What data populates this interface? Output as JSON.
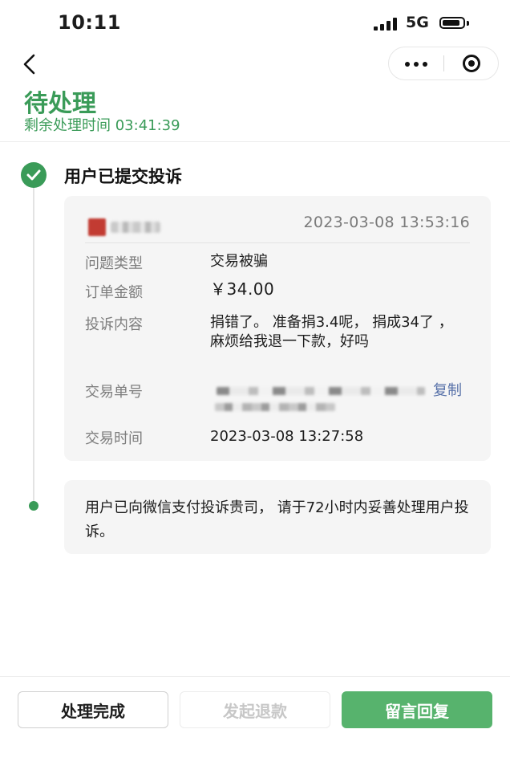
{
  "status_bar": {
    "time": "10:11",
    "network": "5G"
  },
  "header": {
    "title": "待处理",
    "remaining_time": "剩余处理时间 03:41:39"
  },
  "timeline": {
    "step_title": "用户已提交投诉",
    "complaint": {
      "submitted_at": "2023-03-08 13:53:16",
      "fields": [
        {
          "label": "问题类型",
          "value": "交易被骗"
        },
        {
          "label": "订单金额",
          "value": "￥34.00"
        },
        {
          "label": "投诉内容",
          "value": "捐错了。 准备捐3.4呢， 捐成34了 ， 麻烦给我退一下款，好吗"
        },
        {
          "label": "交易单号",
          "value": ""
        },
        {
          "label": "交易时间",
          "value": "2023-03-08 13:27:58"
        }
      ],
      "copy_label": "复制"
    },
    "notice": "用户已向微信支付投诉贵司， 请于72小时内妥善处理用户投诉。"
  },
  "actions": {
    "done": "处理完成",
    "refund": "发起退款",
    "reply": "留言回复"
  },
  "colors": {
    "brand_green": "#3a9b58",
    "button_green": "#57b36d",
    "card_bg": "#f5f5f5",
    "link": "#5670a8"
  }
}
